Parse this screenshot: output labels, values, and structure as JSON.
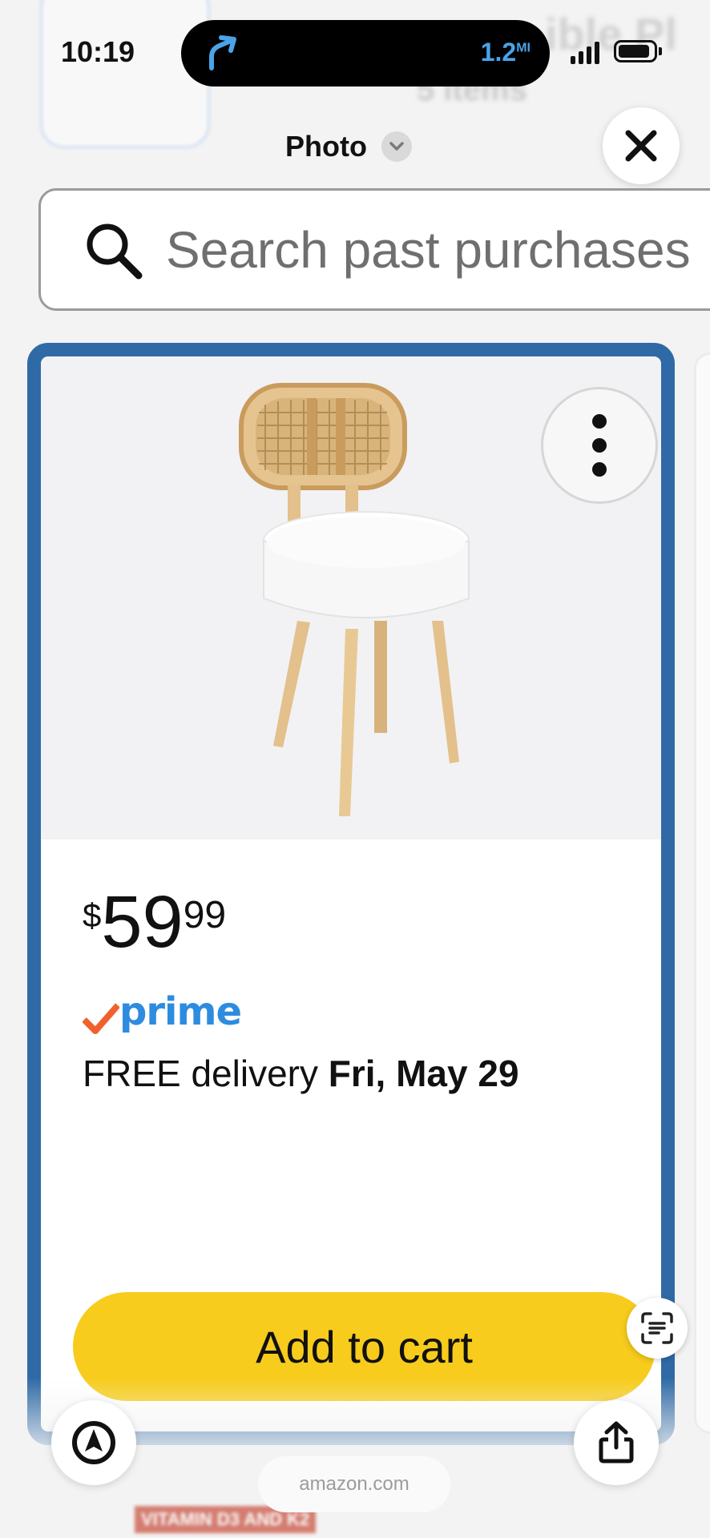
{
  "status_bar": {
    "time": "10:19",
    "nav_distance": "1.2",
    "nav_unit": "MI"
  },
  "background": {
    "text_1": "5 items",
    "text_2": "ible Pl",
    "bottom_product_label": "VITAMIN D3 AND K2"
  },
  "header": {
    "title": "Photo",
    "close_icon": "close-icon",
    "dropdown_icon": "chevron-down-icon"
  },
  "search": {
    "placeholder": "Search past purchases"
  },
  "product": {
    "price_currency": "$",
    "price_whole": "59",
    "price_fraction": "99",
    "prime_label": "prime",
    "delivery_prefix": "FREE delivery ",
    "delivery_date": "Fri, May 29",
    "add_to_cart_label": "Add to cart",
    "image_icon": "chair-image",
    "accent_color": "#2f6aa6",
    "button_color": "#f7cc1c",
    "prime_color": "#2d8cdf",
    "check_color": "#f0622d"
  },
  "bottom_bar": {
    "url": "amazon.com"
  }
}
